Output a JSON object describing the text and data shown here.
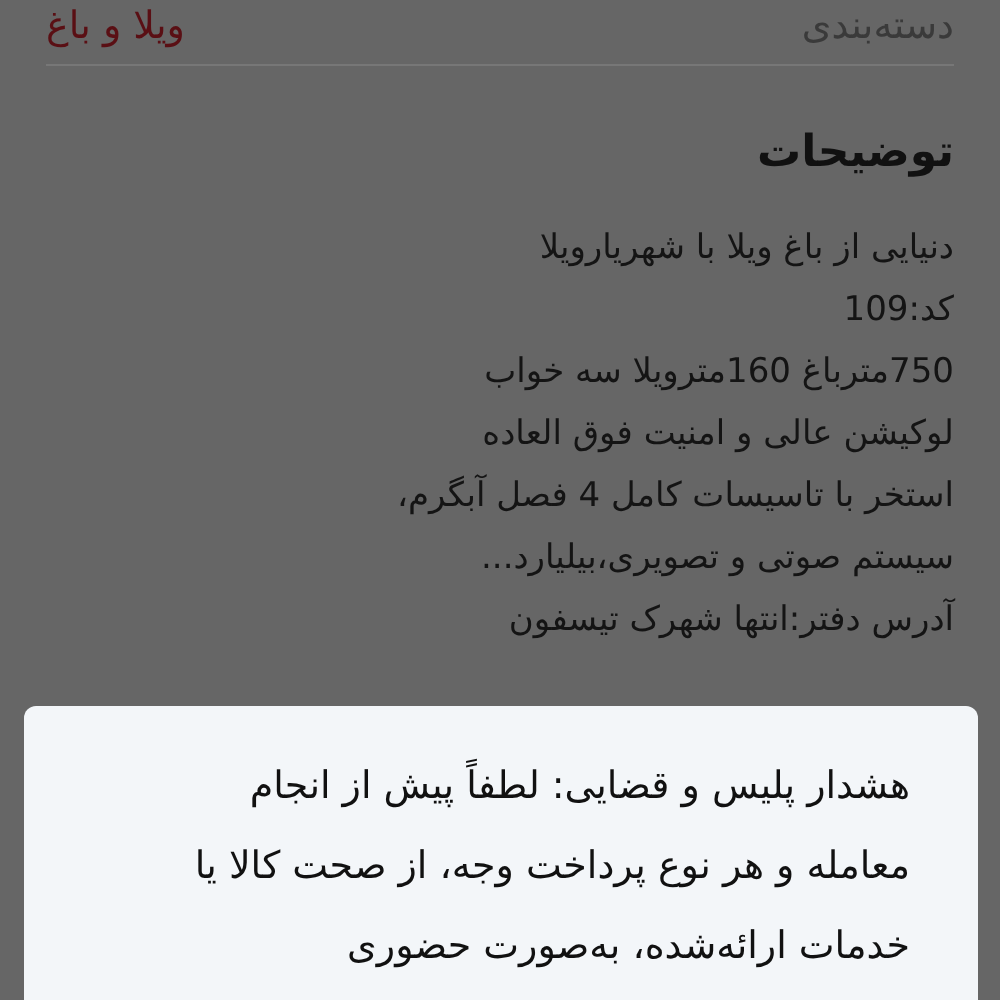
{
  "category_row": {
    "label": "دسته‌بندی",
    "value": "ویلا و باغ"
  },
  "description": {
    "title": "توضیحات",
    "lines": [
      "دنیایی از باغ ویلا با شهریارویلا",
      "کد:109",
      "750مترباغ 160مترویلا سه خواب",
      "لوکیشن عالی و امنیت فوق العاده",
      "استخر با تاسیسات کامل 4 فصل آبگرم،",
      "سیستم صوتی و تصویری،بیلیارد...",
      "آدرس دفتر:انتها شهرک تیسفون"
    ]
  },
  "warning_dialog": {
    "text": "هشدار پلیس و قضایی: لطفاً پیش از انجام معامله و هر نوع پرداخت وجه، از صحت کالا یا خدمات ارائه‌شده، به‌صورت حضوری"
  }
}
